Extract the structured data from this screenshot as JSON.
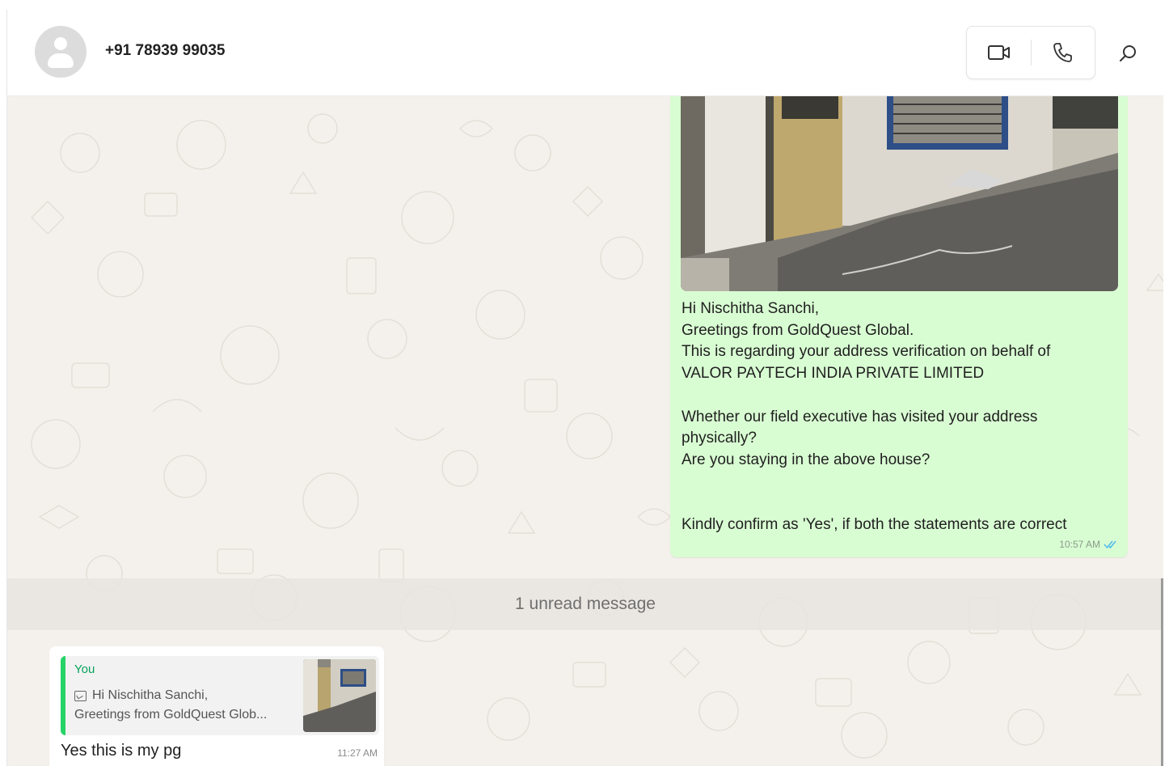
{
  "header": {
    "contact_name": "+91 78939 99035",
    "avatar_icon": "person-avatar-icon",
    "video_call_icon": "video-camera-icon",
    "voice_call_icon": "phone-icon",
    "search_icon": "search-icon"
  },
  "outgoing_message": {
    "image_icon": "photo-of-house",
    "text": "Hi Nischitha Sanchi,\nGreetings from GoldQuest Global.\nThis is regarding your address verification on behalf of\nVALOR PAYTECH INDIA PRIVATE LIMITED\n\nWhether our field executive has visited your address\nphysically?\nAre you staying in the above house?\n\n\nKindly confirm as 'Yes', if both the statements are correct",
    "time": "10:57 AM",
    "status_icon": "double-check-read-icon",
    "status_color": "#53bdeb"
  },
  "unread_divider": {
    "label": "1 unread message"
  },
  "incoming_message": {
    "quoted": {
      "author": "You",
      "line1": "Hi Nischitha Sanchi,",
      "line2": "Greetings from GoldQuest Glob...",
      "media_icon": "image-icon"
    },
    "text": "Yes this is my pg",
    "time": "11:27 AM"
  },
  "colors": {
    "outgoing_bubble": "#d9fdd3",
    "incoming_bubble": "#ffffff",
    "chat_background": "#f4f1ec",
    "quote_accent": "#25d366",
    "quote_author": "#06a35b"
  }
}
